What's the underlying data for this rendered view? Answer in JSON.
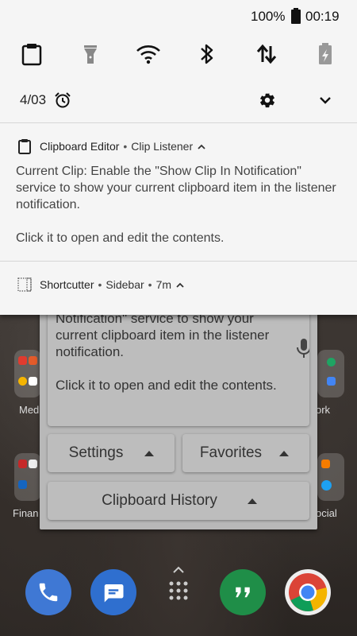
{
  "status_bar": {
    "battery_percent": "100%",
    "time": "00:19"
  },
  "quick_settings": {
    "tiles": [
      {
        "icon": "clipboard-icon"
      },
      {
        "icon": "flashlight-icon"
      },
      {
        "icon": "wifi-icon"
      },
      {
        "icon": "bluetooth-icon"
      },
      {
        "icon": "mobile-data-icon"
      },
      {
        "icon": "battery-saver-icon"
      }
    ],
    "date": "4/03",
    "alarm_icon": "alarm-icon",
    "settings_icon": "gear-icon",
    "expand_icon": "chevron-down-icon"
  },
  "notifications": [
    {
      "app": "Clipboard Editor",
      "channel": "Clip Listener",
      "body": "Current Clip: Enable the \"Show Clip In Notification\" service to show your current clipboard item in the listener notification.\n\nClick it to open and edit the contents."
    },
    {
      "app": "Shortcutter",
      "channel": "Sidebar",
      "time": "7m"
    }
  ],
  "dialog": {
    "text": "Notification\" service to show your current clipboard item in the listener notification.\n\nClick it to open and edit the contents.",
    "settings_label": "Settings",
    "favorites_label": "Favorites",
    "history_label": "Clipboard History"
  },
  "home": {
    "folders": [
      {
        "label": "Med"
      },
      {
        "label": "ork"
      },
      {
        "label": "Finan"
      },
      {
        "label": "ocial"
      }
    ]
  },
  "colors": {
    "shade_background": "#f5f5f5",
    "dialog_background": "#bdbdbd"
  }
}
